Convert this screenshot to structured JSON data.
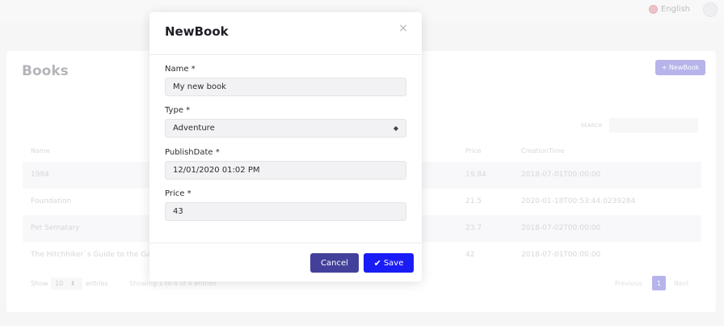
{
  "header": {
    "language": "English",
    "language_icon": "globe-icon",
    "user_icon": "user-avatar-icon"
  },
  "page": {
    "title": "Books",
    "new_book_button": "+ NewBook",
    "search_label": "SEARCH",
    "search_value": ""
  },
  "table": {
    "columns": [
      "Name",
      "Price",
      "CreationTime"
    ],
    "rows": [
      {
        "name": "1984",
        "price": "19.84",
        "creation_time": "2018-07-01T00:00:00"
      },
      {
        "name": "Foundation",
        "price": "21.5",
        "creation_time": "2020-01-18T00:53:44.0239284"
      },
      {
        "name": "Pet Sematary",
        "price": "23.7",
        "creation_time": "2018-07-02T00:00:00"
      },
      {
        "name": "The Hitchhiker`s Guide to the Ga",
        "price": "42",
        "creation_time": "2018-07-01T00:00:00"
      }
    ]
  },
  "pagination": {
    "show_label": "Show",
    "page_size": "10",
    "entries_label": "entries",
    "showing_text": "Showing 1 to 4 of 4 entries",
    "previous": "Previous",
    "current_page": "1",
    "next": "Next"
  },
  "modal": {
    "title": "NewBook",
    "close_icon": "close-icon",
    "name_label": "Name *",
    "name_value": "My new book",
    "type_label": "Type *",
    "type_value": "Adventure",
    "publish_date_label": "PublishDate *",
    "publish_date_value": "12/01/2020 01:02 PM",
    "price_label": "Price *",
    "price_value": "43",
    "cancel_label": "Cancel",
    "save_label": "Save"
  },
  "colors": {
    "primary": "#1a1cf5",
    "secondary": "#43409b",
    "accent": "#8f8ce0"
  }
}
